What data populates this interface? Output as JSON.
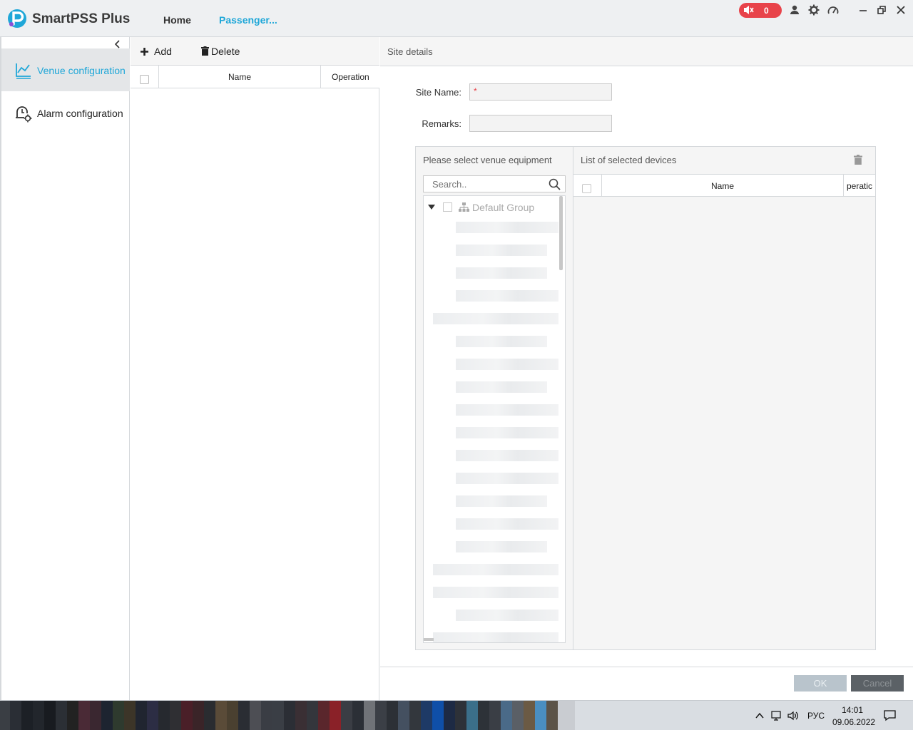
{
  "app": {
    "name": "SmartPSS Plus",
    "nav": [
      {
        "label": "Home"
      },
      {
        "label": "Passenger..."
      }
    ],
    "alarm_count": "0",
    "colors": {
      "accent": "#1fa7d8",
      "alarm": "#e8434a"
    }
  },
  "sidebar": {
    "items": [
      {
        "label": "Venue configuration",
        "icon": "venue-chart-icon"
      },
      {
        "label": "Alarm configuration",
        "icon": "alarm-user-gear-icon"
      }
    ]
  },
  "list": {
    "add_label": "Add",
    "delete_label": "Delete",
    "columns": [
      "Name",
      "Operation"
    ]
  },
  "details": {
    "title": "Site details",
    "site_name_label": "Site Name:",
    "site_name_value": "",
    "required_mark": "*",
    "remarks_label": "Remarks:",
    "remarks_value": "",
    "equipment": {
      "title": "Please select venue equipment",
      "search_placeholder": "Search..",
      "tree_root": "Default Group"
    },
    "selected": {
      "title": "List of selected devices",
      "columns": [
        "Name",
        "peratic"
      ]
    },
    "ok_label": "OK",
    "cancel_label": "Cancel"
  },
  "taskbar": {
    "language": "РУС",
    "time": "14:01",
    "date": "09.06.2022"
  }
}
